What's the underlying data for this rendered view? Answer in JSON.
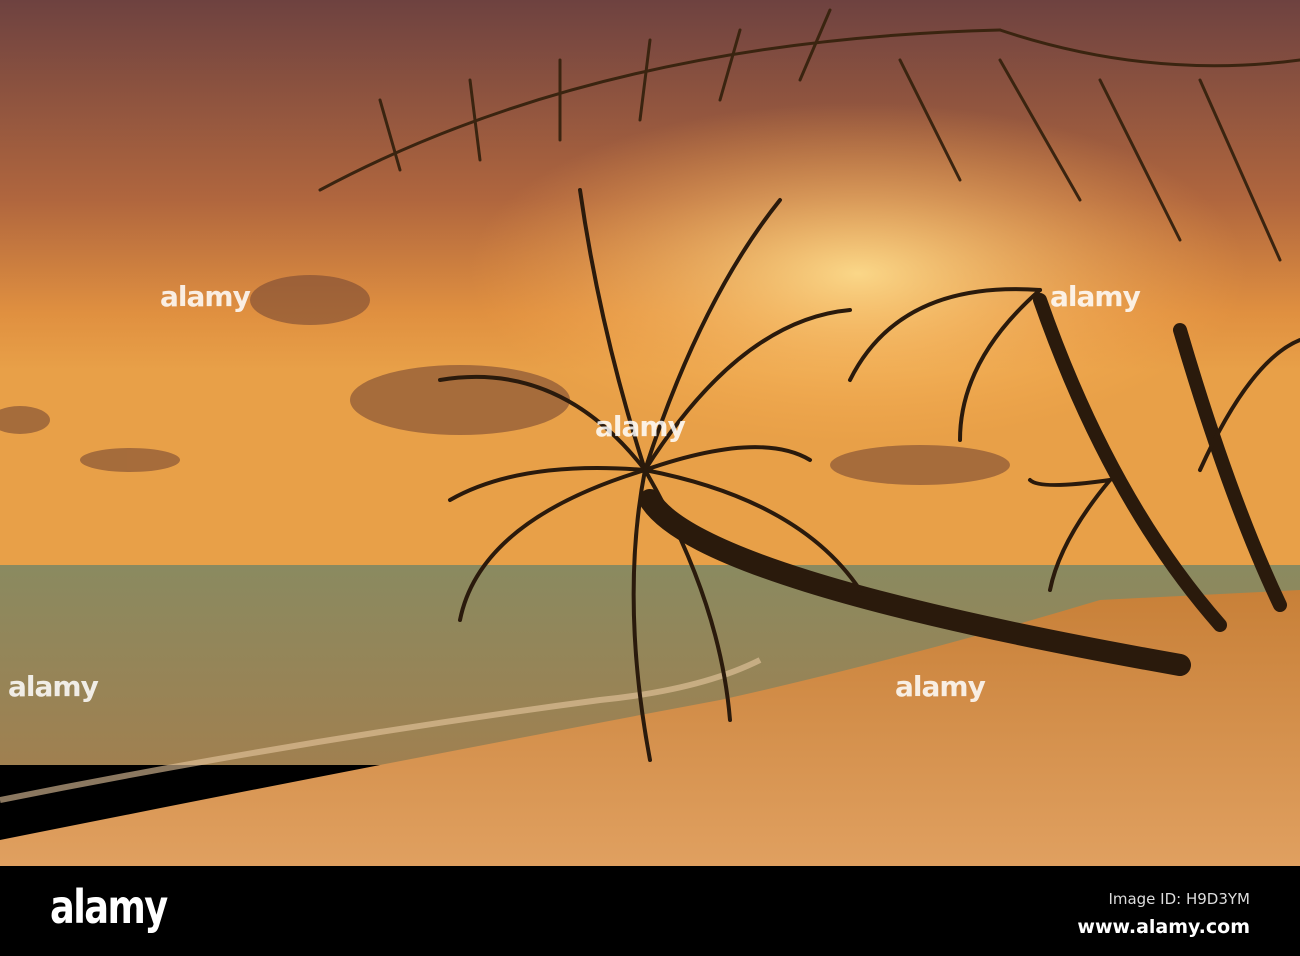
{
  "watermark": {
    "text": "alamy"
  },
  "footer": {
    "logo": "alamy",
    "image_id": "Image ID: H9D3YM",
    "website": "www.alamy.com"
  },
  "colors": {
    "sky_top": "#7a4a40",
    "sky_glow": "#f0a040",
    "sea": "#6a7a60",
    "sand": "#d08a40",
    "silhouette": "#2a1a0c"
  }
}
